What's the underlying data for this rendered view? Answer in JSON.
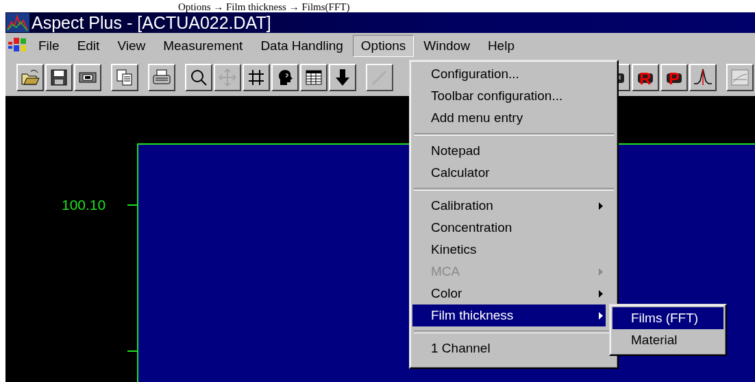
{
  "caption": "Options → Film thickness → Films(FFT)",
  "window": {
    "title": "Aspect Plus - [ACTUA022.DAT]"
  },
  "menu_bar": [
    {
      "label": "File",
      "selected": false
    },
    {
      "label": "Edit",
      "selected": false
    },
    {
      "label": "View",
      "selected": false
    },
    {
      "label": "Measurement",
      "selected": false
    },
    {
      "label": "Data Handling",
      "selected": false
    },
    {
      "label": "Options",
      "selected": true
    },
    {
      "label": "Window",
      "selected": false
    },
    {
      "label": "Help",
      "selected": false
    }
  ],
  "toolbar": [
    {
      "kind": "open",
      "disabled": false
    },
    {
      "kind": "save",
      "disabled": false
    },
    {
      "kind": "tape",
      "disabled": false
    },
    {
      "kind": "copy",
      "disabled": false
    },
    {
      "kind": "print",
      "disabled": false
    },
    {
      "kind": "search",
      "disabled": false
    },
    {
      "kind": "move",
      "disabled": true
    },
    {
      "kind": "grid",
      "disabled": false
    },
    {
      "kind": "head",
      "disabled": false
    },
    {
      "kind": "table",
      "disabled": false
    },
    {
      "kind": "down",
      "disabled": false
    },
    {
      "kind": "wand",
      "disabled": true
    },
    {
      "kind": "gap"
    },
    {
      "kind": "device",
      "disabled": false
    },
    {
      "kind": "letter",
      "label": "R",
      "disabled": false
    },
    {
      "kind": "letter",
      "label": "P",
      "disabled": false
    },
    {
      "kind": "peak",
      "disabled": false
    },
    {
      "kind": "chart",
      "disabled": false
    }
  ],
  "plot": {
    "y_tick_label": "100.10"
  },
  "options_menu": [
    {
      "kind": "item",
      "label": "Configuration...",
      "submenu": false,
      "disabled": false,
      "selected": false
    },
    {
      "kind": "item",
      "label": "Toolbar configuration...",
      "submenu": false,
      "disabled": false,
      "selected": false
    },
    {
      "kind": "item",
      "label": "Add menu entry",
      "submenu": false,
      "disabled": false,
      "selected": false
    },
    {
      "kind": "separator"
    },
    {
      "kind": "item",
      "label": "Notepad",
      "submenu": false,
      "disabled": false,
      "selected": false
    },
    {
      "kind": "item",
      "label": "Calculator",
      "submenu": false,
      "disabled": false,
      "selected": false
    },
    {
      "kind": "separator"
    },
    {
      "kind": "item",
      "label": "Calibration",
      "submenu": true,
      "disabled": false,
      "selected": false
    },
    {
      "kind": "item",
      "label": "Concentration",
      "submenu": false,
      "disabled": false,
      "selected": false
    },
    {
      "kind": "item",
      "label": "Kinetics",
      "submenu": false,
      "disabled": false,
      "selected": false
    },
    {
      "kind": "item",
      "label": "MCA",
      "submenu": true,
      "disabled": true,
      "selected": false
    },
    {
      "kind": "item",
      "label": "Color",
      "submenu": true,
      "disabled": false,
      "selected": false
    },
    {
      "kind": "item",
      "label": "Film thickness",
      "submenu": true,
      "disabled": false,
      "selected": true
    },
    {
      "kind": "separator"
    },
    {
      "kind": "item",
      "label": "1 Channel",
      "submenu": false,
      "disabled": false,
      "selected": false
    }
  ],
  "film_thickness_submenu": [
    {
      "kind": "item",
      "label": "Films (FFT)",
      "submenu": false,
      "disabled": false,
      "selected": true
    },
    {
      "kind": "item",
      "label": "Material",
      "submenu": false,
      "disabled": false,
      "selected": false
    }
  ]
}
